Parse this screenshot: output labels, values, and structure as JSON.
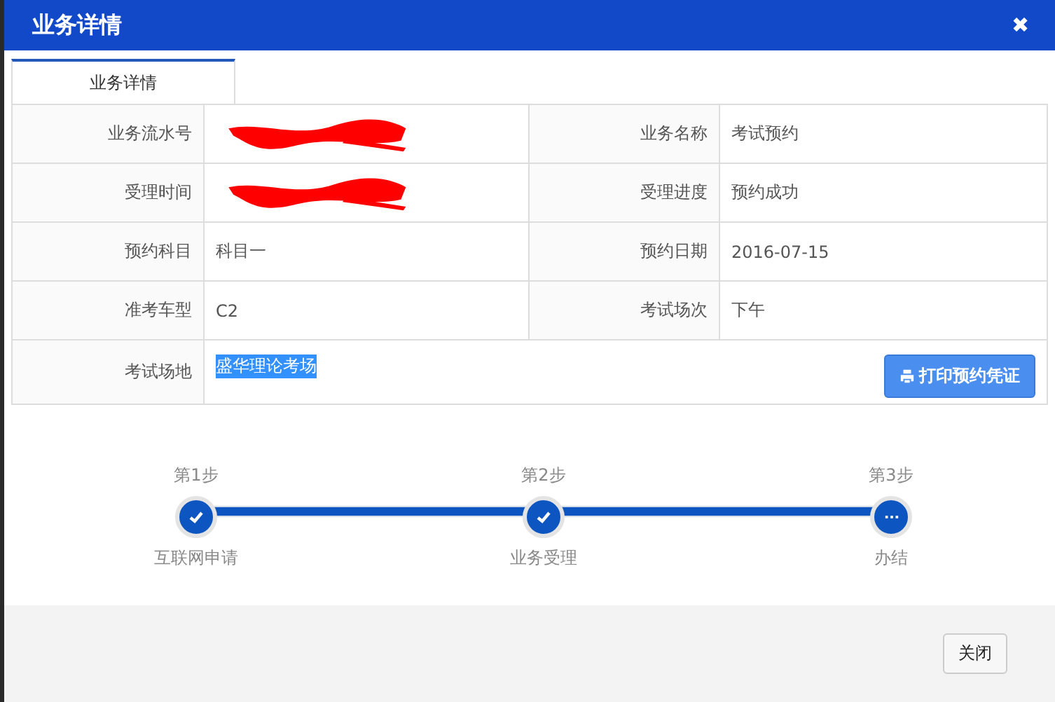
{
  "dialog": {
    "title": "业务详情",
    "close_icon": "✖"
  },
  "tabs": [
    {
      "label": "业务详情",
      "selected": true
    }
  ],
  "details": [
    {
      "label": "业务流水号",
      "redacted": true,
      "label_2": "业务名称",
      "value_2": "考试预约"
    },
    {
      "label": "受理时间",
      "redacted": true,
      "label_2": "受理进度",
      "value_2": "预约成功"
    },
    {
      "label": "预约科目",
      "value": "科目一",
      "redacted": false,
      "label_2": "预约日期",
      "value_2": "2016-07-15"
    },
    {
      "label": "准考车型",
      "value": "C2",
      "redacted": false,
      "label_2": "考试场次",
      "value_2": "下午"
    }
  ],
  "venue": {
    "label": "考试场地",
    "value": "盛华理论考场",
    "highlighted": true
  },
  "print_button": {
    "label": "打印预约凭证"
  },
  "steps": [
    {
      "number": "第1步",
      "name": "互联网申请",
      "completed": true
    },
    {
      "number": "第2步",
      "name": "业务受理",
      "completed": true
    },
    {
      "number": "第3步",
      "name": "办结",
      "completed": false
    }
  ],
  "footer": {
    "close_button": "关闭"
  }
}
